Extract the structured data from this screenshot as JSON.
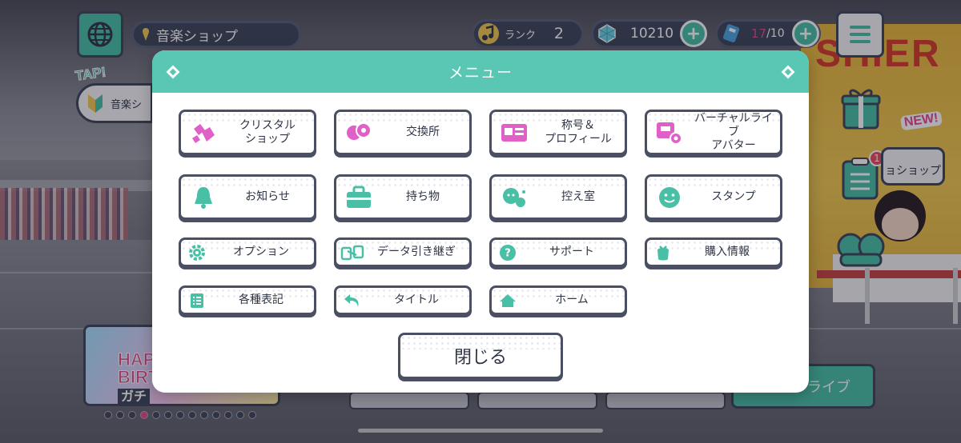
{
  "hud": {
    "location": "音楽ショップ",
    "tap_label": "TAP!",
    "tap_text": "音楽シ",
    "rank_label": "ランク",
    "rank_value": "2",
    "gems": "10210",
    "tickets_current": "17",
    "tickets_max": "/10"
  },
  "side": {
    "new_tag": "NEW!",
    "shop_bubble": "ョショップ",
    "badge_count": "1"
  },
  "background": {
    "cashier_sign": "SHIER",
    "banner_text_1": "HAP",
    "banner_text_2": "BIRTH",
    "banner_text_3": "ガチ",
    "live_button": "ライブ",
    "carousel_dots": 13,
    "carousel_active": 3
  },
  "colors": {
    "accent": "#5ac6b4",
    "pink": "#e8468c",
    "navy": "#3d4458"
  },
  "menu": {
    "title": "メニュー",
    "rows": [
      [
        {
          "label": "クリスタル\nショップ",
          "icon": "crystal-icon"
        },
        {
          "label": "交換所",
          "icon": "exchange-icon"
        },
        {
          "label": "称号＆\nプロフィール",
          "icon": "profile-card-icon"
        },
        {
          "label": "バーチャルライブ\nアバター",
          "icon": "avatar-gear-icon"
        }
      ],
      [
        {
          "label": "お知らせ",
          "icon": "bell-icon"
        },
        {
          "label": "持ち物",
          "icon": "bag-icon"
        },
        {
          "label": "控え室",
          "icon": "waiting-room-icon"
        },
        {
          "label": "スタンプ",
          "icon": "smile-stamp-icon"
        }
      ],
      [
        {
          "label": "オプション",
          "icon": "gear-icon"
        },
        {
          "label": "データ引き継ぎ",
          "icon": "data-transfer-icon"
        },
        {
          "label": "サポート",
          "icon": "question-icon"
        },
        {
          "label": "購入情報",
          "icon": "purchase-bag-icon"
        }
      ],
      [
        {
          "label": "各種表記",
          "icon": "list-icon"
        },
        {
          "label": "タイトル",
          "icon": "back-arrow-icon"
        },
        {
          "label": "ホーム",
          "icon": "home-icon"
        }
      ]
    ],
    "close_label": "閉じる"
  }
}
